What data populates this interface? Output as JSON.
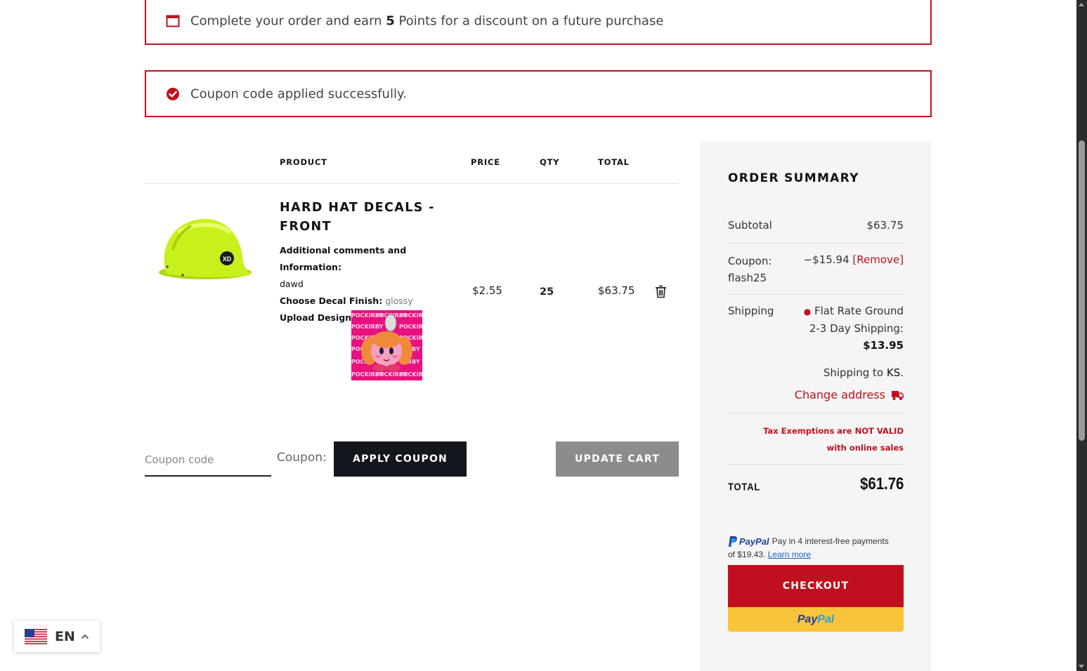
{
  "notices": {
    "points": {
      "prefix": "Complete your order and earn ",
      "points": "5",
      "suffix": " Points for a discount on a future purchase"
    },
    "coupon": "Coupon code applied successfully."
  },
  "cart": {
    "headers": {
      "product": "PRODUCT",
      "price": "PRICE",
      "qty": "QTY",
      "total": "TOTAL"
    },
    "item": {
      "name": "HARD HAT DECALS - FRONT",
      "comments_label": "Additional comments and Information:",
      "comments_value": "dawd",
      "finish_label": "Choose Decal Finish:",
      "finish_value": "glossy",
      "upload_label": "Upload Design:",
      "design_text": "POCKIRBY",
      "price": "$2.55",
      "qty": "25",
      "total": "$63.75"
    },
    "coupon_placeholder": "Coupon code",
    "coupon_label": "Coupon:",
    "apply_label": "APPLY COUPON",
    "update_label": "UPDATE CART"
  },
  "summary": {
    "title": "ORDER SUMMARY",
    "subtotal_label": "Subtotal",
    "subtotal_value": "$63.75",
    "coupon_label": "Coupon:",
    "coupon_code": "flash25",
    "coupon_value": "−$15.94",
    "remove_label": "[Remove]",
    "shipping_label": "Shipping",
    "shipping_method_1": "Flat Rate Ground",
    "shipping_method_2": "2-3 Day Shipping:",
    "shipping_price": "$13.95",
    "shipping_to_prefix": "Shipping to ",
    "shipping_to_state": "KS",
    "shipping_to_suffix": ".",
    "change_address": "Change address",
    "tax_line_1": "Tax Exemptions are NOT VALID",
    "tax_line_2": "with online sales",
    "total_label": "TOTAL",
    "total_value": "$61.76"
  },
  "paypal": {
    "brand": "PayPal",
    "message_1": "Pay in 4 interest-free payments",
    "message_2": "of $19.43.",
    "learn_more": "Learn more",
    "button_part1": "Pay",
    "button_part2": "Pal"
  },
  "checkout_label": "CHECKOUT",
  "language": {
    "code": "EN"
  },
  "colors": {
    "accent": "#c0101e",
    "dark_button": "#13161d",
    "gray_button": "#8c8c8f",
    "paypal_yellow": "#f8c43a",
    "helmet": "#c8f01a",
    "design_pink": "#e8117f"
  }
}
